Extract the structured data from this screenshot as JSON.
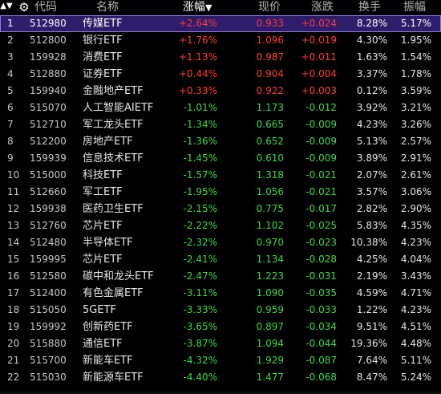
{
  "header": {
    "sort_glyph": "▲▼",
    "settings_icon": "gear-icon",
    "code": "代码",
    "name": "名称",
    "change_pct": "涨幅",
    "change_pct_arrow": "▼",
    "price": "现价",
    "change": "涨跌",
    "turnover": "换手",
    "amplitude": "振幅"
  },
  "colors": {
    "up": "#ff3c3c",
    "down": "#3cd84b",
    "selected_row": "#2f1c6a",
    "background": "#000000"
  },
  "selected_index": 0,
  "rows": [
    {
      "idx": "1",
      "code": "512980",
      "name": "传媒ETF",
      "chg_pct": "+2.64%",
      "price": "0.933",
      "chg": "+0.024",
      "turnover": "8.28%",
      "amplitude": "5.17%",
      "dir": "up"
    },
    {
      "idx": "2",
      "code": "512800",
      "name": "银行ETF",
      "chg_pct": "+1.76%",
      "price": "1.096",
      "chg": "+0.019",
      "turnover": "4.30%",
      "amplitude": "1.95%",
      "dir": "up"
    },
    {
      "idx": "3",
      "code": "159928",
      "name": "消费ETF",
      "chg_pct": "+1.13%",
      "price": "0.987",
      "chg": "+0.011",
      "turnover": "1.63%",
      "amplitude": "1.54%",
      "dir": "up"
    },
    {
      "idx": "4",
      "code": "512880",
      "name": "证券ETF",
      "chg_pct": "+0.44%",
      "price": "0.904",
      "chg": "+0.004",
      "turnover": "3.37%",
      "amplitude": "1.78%",
      "dir": "up"
    },
    {
      "idx": "5",
      "code": "159940",
      "name": "金融地产ETF",
      "chg_pct": "+0.33%",
      "price": "0.922",
      "chg": "+0.003",
      "turnover": "0.12%",
      "amplitude": "3.59%",
      "dir": "up"
    },
    {
      "idx": "6",
      "code": "515070",
      "name": "人工智能AIETF",
      "chg_pct": "-1.01%",
      "price": "1.173",
      "chg": "-0.012",
      "turnover": "3.92%",
      "amplitude": "3.21%",
      "dir": "down"
    },
    {
      "idx": "7",
      "code": "512710",
      "name": "军工龙头ETF",
      "chg_pct": "-1.34%",
      "price": "0.665",
      "chg": "-0.009",
      "turnover": "4.23%",
      "amplitude": "3.26%",
      "dir": "down"
    },
    {
      "idx": "8",
      "code": "512200",
      "name": "房地产ETF",
      "chg_pct": "-1.36%",
      "price": "0.652",
      "chg": "-0.009",
      "turnover": "5.13%",
      "amplitude": "2.57%",
      "dir": "down"
    },
    {
      "idx": "9",
      "code": "159939",
      "name": "信息技术ETF",
      "chg_pct": "-1.45%",
      "price": "0.610",
      "chg": "-0.009",
      "turnover": "3.89%",
      "amplitude": "2.91%",
      "dir": "down"
    },
    {
      "idx": "10",
      "code": "515000",
      "name": "科技ETF",
      "chg_pct": "-1.57%",
      "price": "1.318",
      "chg": "-0.021",
      "turnover": "2.07%",
      "amplitude": "2.61%",
      "dir": "down"
    },
    {
      "idx": "11",
      "code": "512660",
      "name": "军工ETF",
      "chg_pct": "-1.95%",
      "price": "1.056",
      "chg": "-0.021",
      "turnover": "3.57%",
      "amplitude": "3.06%",
      "dir": "down"
    },
    {
      "idx": "12",
      "code": "159938",
      "name": "医药卫生ETF",
      "chg_pct": "-2.15%",
      "price": "0.775",
      "chg": "-0.017",
      "turnover": "2.82%",
      "amplitude": "2.90%",
      "dir": "down"
    },
    {
      "idx": "13",
      "code": "512760",
      "name": "芯片ETF",
      "chg_pct": "-2.22%",
      "price": "1.102",
      "chg": "-0.025",
      "turnover": "5.83%",
      "amplitude": "4.35%",
      "dir": "down"
    },
    {
      "idx": "14",
      "code": "512480",
      "name": "半导体ETF",
      "chg_pct": "-2.32%",
      "price": "0.970",
      "chg": "-0.023",
      "turnover": "10.38%",
      "amplitude": "4.23%",
      "dir": "down"
    },
    {
      "idx": "15",
      "code": "159995",
      "name": "芯片ETF",
      "chg_pct": "-2.41%",
      "price": "1.134",
      "chg": "-0.028",
      "turnover": "4.25%",
      "amplitude": "4.04%",
      "dir": "down"
    },
    {
      "idx": "16",
      "code": "512580",
      "name": "碳中和龙头ETF",
      "chg_pct": "-2.47%",
      "price": "1.223",
      "chg": "-0.031",
      "turnover": "2.19%",
      "amplitude": "3.43%",
      "dir": "down"
    },
    {
      "idx": "17",
      "code": "512400",
      "name": "有色金属ETF",
      "chg_pct": "-3.11%",
      "price": "1.090",
      "chg": "-0.035",
      "turnover": "4.59%",
      "amplitude": "4.71%",
      "dir": "down"
    },
    {
      "idx": "18",
      "code": "515050",
      "name": "5GETF",
      "chg_pct": "-3.33%",
      "price": "0.959",
      "chg": "-0.033",
      "turnover": "1.22%",
      "amplitude": "4.23%",
      "dir": "down"
    },
    {
      "idx": "19",
      "code": "159992",
      "name": "创新药ETF",
      "chg_pct": "-3.65%",
      "price": "0.897",
      "chg": "-0.034",
      "turnover": "9.51%",
      "amplitude": "4.51%",
      "dir": "down"
    },
    {
      "idx": "20",
      "code": "515880",
      "name": "通信ETF",
      "chg_pct": "-3.87%",
      "price": "1.094",
      "chg": "-0.044",
      "turnover": "19.36%",
      "amplitude": "4.48%",
      "dir": "down"
    },
    {
      "idx": "21",
      "code": "515700",
      "name": "新能车ETF",
      "chg_pct": "-4.32%",
      "price": "1.929",
      "chg": "-0.087",
      "turnover": "7.64%",
      "amplitude": "5.11%",
      "dir": "down"
    },
    {
      "idx": "22",
      "code": "515030",
      "name": "新能源车ETF",
      "chg_pct": "-4.40%",
      "price": "1.477",
      "chg": "-0.068",
      "turnover": "8.47%",
      "amplitude": "5.24%",
      "dir": "down"
    }
  ]
}
